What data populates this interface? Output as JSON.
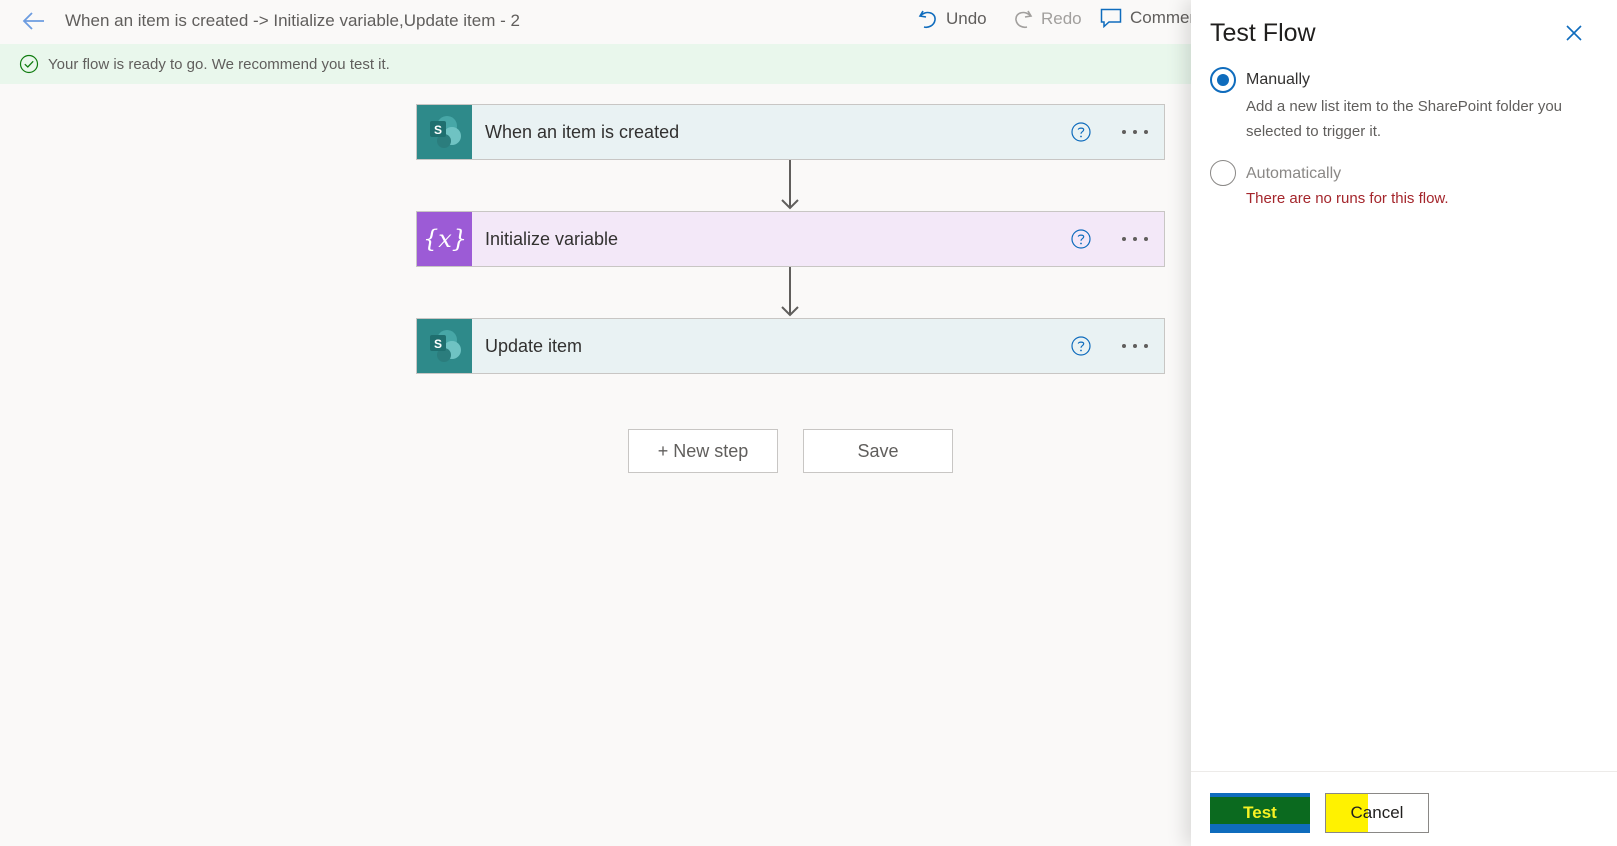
{
  "header": {
    "title": "When an item is created -> Initialize variable,Update item - 2",
    "undo_label": "Undo",
    "redo_label": "Redo",
    "comments_label": "Comments"
  },
  "banner": {
    "text": "Your flow is ready to go. We recommend you test it."
  },
  "steps": [
    {
      "title": "When an item is created",
      "icon": "sharepoint-icon"
    },
    {
      "title": "Initialize variable",
      "icon": "variable-icon"
    },
    {
      "title": "Update item",
      "icon": "sharepoint-icon"
    }
  ],
  "canvas": {
    "new_step_label": "+ New step",
    "save_label": "Save"
  },
  "panel": {
    "title": "Test Flow",
    "options": [
      {
        "label": "Manually",
        "description": "Add a new list item to the SharePoint folder you selected to trigger it.",
        "selected": true
      },
      {
        "label": "Automatically",
        "description": "There are no runs for this flow.",
        "selected": false
      }
    ],
    "test_label": "Test",
    "cancel_label": "Cancel"
  },
  "colors": {
    "accent": "#0f6cbd",
    "sharepoint": "#2e8a8a",
    "variable": "#9c5bd6",
    "error": "#a4262c"
  }
}
